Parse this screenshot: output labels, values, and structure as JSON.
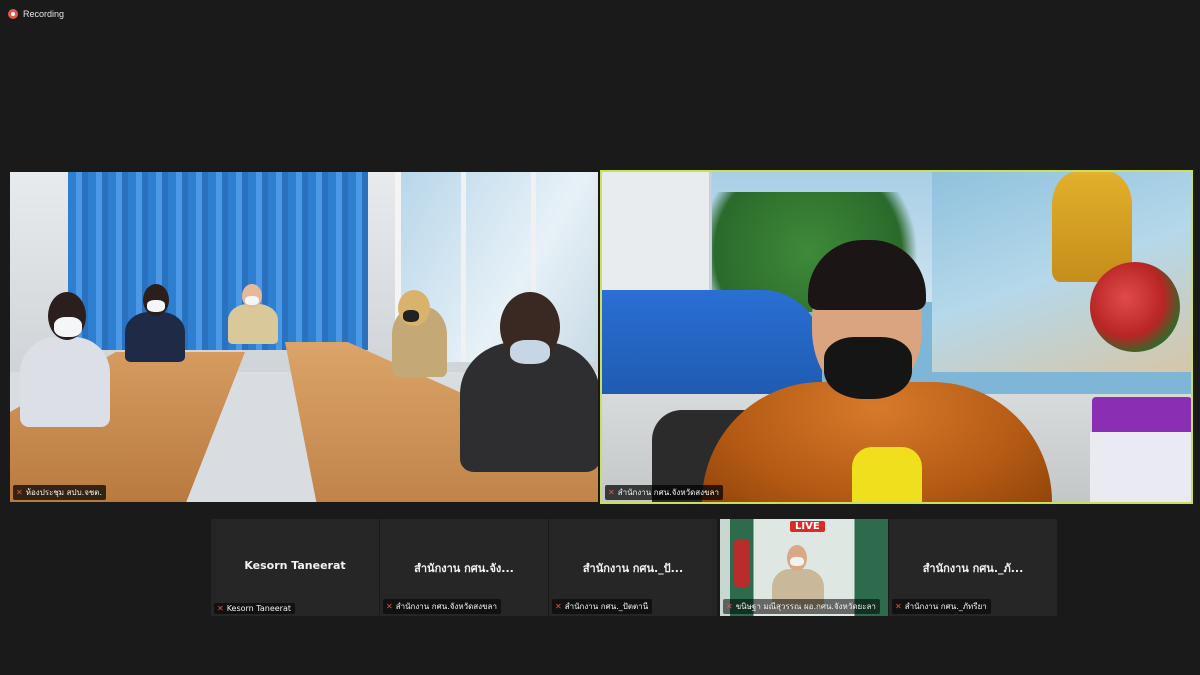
{
  "recording": {
    "label": "Recording"
  },
  "main_tiles": {
    "room": {
      "label": "ห้องประชุม สปบ.จชต."
    },
    "speaker": {
      "label": "สำนักงาน กศน.จังหวัดสงขลา",
      "active_speaker_color": "#c8e05a"
    }
  },
  "thumbnails": [
    {
      "display_name": "Kesorn  Taneerat",
      "label": "Kesorn  Taneerat"
    },
    {
      "display_name": "สำนักงาน กศน.จัง...",
      "label": "สำนักงาน กศน.จังหวัดสงขลา"
    },
    {
      "display_name": "สำนักงาน กศน._ปั...",
      "label": "สำนักงาน กศน._ปัตตานี"
    },
    {
      "live_badge": "LIVE",
      "label": "ขนิษฐา มณีสุวรรณ ผอ.กศน.จังหวัดยะลา"
    },
    {
      "display_name": "สำนักงาน กศน._ภั...",
      "label": "สำนักงาน กศน._ภัทรียา"
    }
  ],
  "icons": {
    "mic_off": "mic-off-icon",
    "recording": "record-icon"
  },
  "colors": {
    "background": "#1a1a1a",
    "tile": "#262626",
    "mic_off": "#e5534b"
  }
}
